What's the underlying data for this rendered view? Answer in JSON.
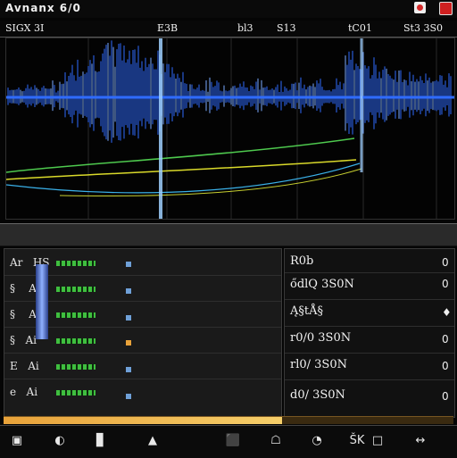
{
  "window": {
    "title": "Avnanx 6/0"
  },
  "info_bar": {
    "left": "SIGX 3I",
    "fields": [
      "E3B",
      "bl3",
      "S13",
      "tC01",
      "St3 3S0"
    ]
  },
  "waveform": {
    "accent": "#2f6bff",
    "glow": "#7aa8ff",
    "overlay_lines": [
      "#4ec94e",
      "#d9d92a",
      "#3ab0e8"
    ],
    "playhead_color": "#9fd0ff"
  },
  "tracks": [
    {
      "name": "Ar   HS",
      "meter": "green"
    },
    {
      "name": "§    Ai",
      "meter": "green"
    },
    {
      "name": "§    Ai",
      "meter": "green"
    },
    {
      "name": "§   Ai",
      "meter": "green"
    },
    {
      "name": "E   Ai",
      "meter": "green"
    },
    {
      "name": "e   Ai",
      "meter": "green"
    }
  ],
  "values": [
    {
      "text": "R0b",
      "icon": "0"
    },
    {
      "text": "ődlQ 3S0N",
      "icon": "0"
    },
    {
      "text": "Ą§tÅ§",
      "icon": "♦"
    },
    {
      "text": "r0/0 3S0N",
      "icon": "0"
    },
    {
      "text": "rl0/ 3S0N",
      "icon": "0"
    },
    {
      "text": "d0/ 3S0N",
      "icon": "0"
    }
  ],
  "playback": {
    "progress": 0.62
  },
  "toolbar": {
    "buttons": [
      "▣",
      "◐",
      "▊",
      "▲",
      "⬛",
      "☖",
      "◔",
      "ŠK",
      "□",
      "↔"
    ]
  }
}
